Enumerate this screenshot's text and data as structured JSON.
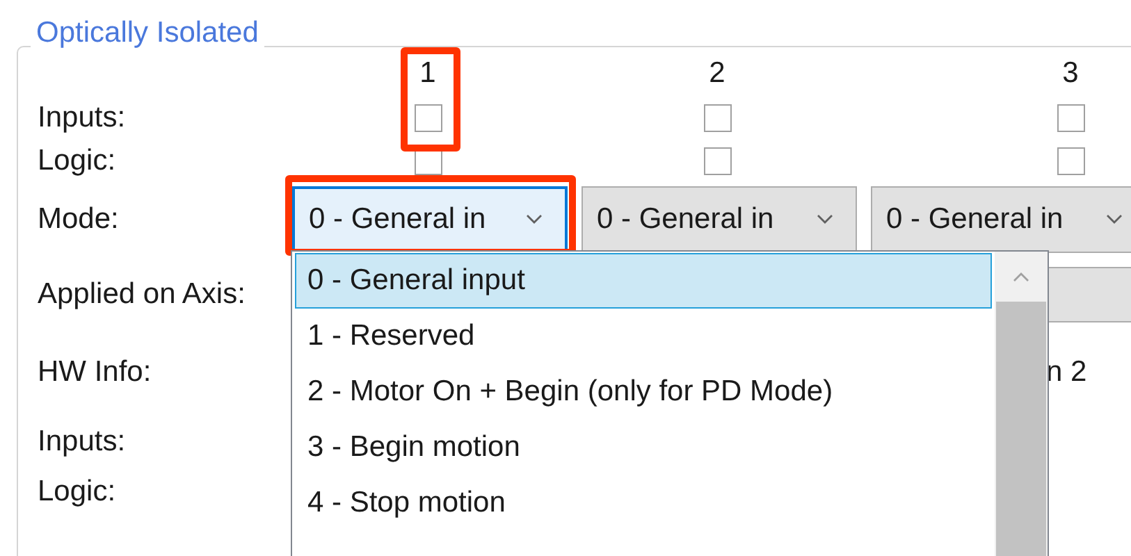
{
  "group": {
    "title": "Optically Isolated"
  },
  "column_headers": [
    {
      "label": "1",
      "marked": true
    },
    {
      "label": "2",
      "marked": false
    },
    {
      "label": "3",
      "marked": false
    }
  ],
  "rows": [
    {
      "kind": "checkboxes",
      "label": "Inputs:",
      "cells": [
        {
          "checked": false
        },
        {
          "checked": false
        },
        {
          "checked": false
        }
      ]
    },
    {
      "kind": "checkboxes",
      "label": "Logic:",
      "cells": [
        {
          "checked": false
        },
        {
          "checked": false
        },
        {
          "checked": false
        }
      ]
    },
    {
      "kind": "combos",
      "label": "Mode:",
      "cells": [
        {
          "value": "0 - General in",
          "focused": true,
          "marked": true
        },
        {
          "value": "0 - General in",
          "focused": false,
          "marked": false
        },
        {
          "value": "0 - General in",
          "focused": false,
          "marked": false
        }
      ]
    },
    {
      "kind": "partial_combo",
      "label": "Applied on Axis:"
    },
    {
      "kind": "partial_text",
      "label": "HW Info:",
      "value": "n 2"
    },
    {
      "kind": "label",
      "label": "Inputs:"
    },
    {
      "kind": "label",
      "label": "Logic:"
    }
  ],
  "dropdown": {
    "items": [
      {
        "label": "0 - General input",
        "selected": true
      },
      {
        "label": "1 - Reserved",
        "selected": false
      },
      {
        "label": "2 - Motor On + Begin (only for PD Mode)",
        "selected": false
      },
      {
        "label": "3 - Begin motion",
        "selected": false
      },
      {
        "label": "4 - Stop motion",
        "selected": false
      }
    ]
  }
}
